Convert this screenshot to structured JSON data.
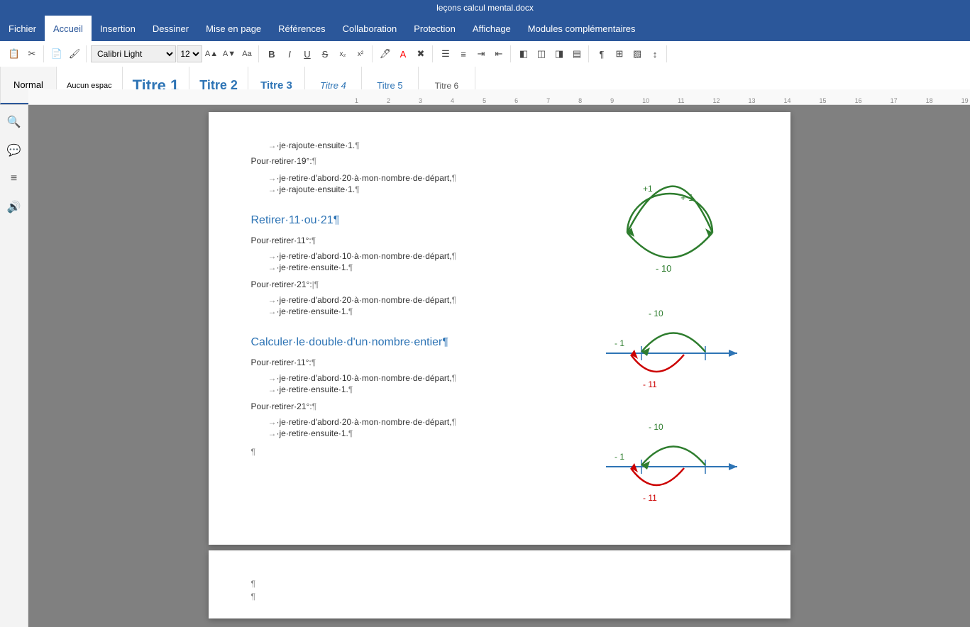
{
  "titlebar": {
    "text": "leçons calcul mental.docx"
  },
  "menu": {
    "items": [
      {
        "id": "fichier",
        "label": "Fichier",
        "active": false
      },
      {
        "id": "accueil",
        "label": "Accueil",
        "active": true
      },
      {
        "id": "insertion",
        "label": "Insertion",
        "active": false
      },
      {
        "id": "dessiner",
        "label": "Dessiner",
        "active": false
      },
      {
        "id": "miseenpage",
        "label": "Mise en page",
        "active": false
      },
      {
        "id": "references",
        "label": "Références",
        "active": false
      },
      {
        "id": "collaboration",
        "label": "Collaboration",
        "active": false
      },
      {
        "id": "protection",
        "label": "Protection",
        "active": false
      },
      {
        "id": "affichage",
        "label": "Affichage",
        "active": false
      },
      {
        "id": "modules",
        "label": "Modules complémentaires",
        "active": false
      }
    ]
  },
  "styles": [
    {
      "id": "normal",
      "label": "Normal",
      "class": ""
    },
    {
      "id": "aucun",
      "label": "Aucun espac",
      "class": ""
    },
    {
      "id": "titre1",
      "label": "Titre 1",
      "class": "titre1"
    },
    {
      "id": "titre2",
      "label": "Titre 2",
      "class": "titre2"
    },
    {
      "id": "titre3",
      "label": "Titre 3",
      "class": "titre3"
    },
    {
      "id": "titre4",
      "label": "Titre 4",
      "class": "titre4"
    },
    {
      "id": "titre5",
      "label": "Titre 5",
      "class": "titre5"
    },
    {
      "id": "titre6",
      "label": "Titre 6",
      "class": "titre6"
    }
  ],
  "toolbar": {
    "font": "Calibri Light",
    "size": "12",
    "bold": "B",
    "italic": "I",
    "underline": "U",
    "strikethrough": "S"
  },
  "sidebar": {
    "icons": [
      "🔍",
      "💬",
      "≡",
      "🔊"
    ]
  },
  "document": {
    "page1": {
      "lines_top": [
        {
          "type": "indent",
          "text": "→·je·rajoute·ensuite·1.¶"
        },
        {
          "type": "blank"
        },
        {
          "type": "para",
          "text": "Pour·retirer·19°:¶"
        },
        {
          "type": "blank"
        },
        {
          "type": "indent",
          "text": "→·je·retire·d'abord·20·à·mon·nombre·de·départ,¶"
        },
        {
          "type": "indent",
          "text": "→·je·rajoute·ensuite·1.¶"
        }
      ],
      "heading1": "Retirer·11·ou·21¶",
      "section1": [
        {
          "type": "para",
          "text": "Pour·retirer·11°:¶"
        },
        {
          "type": "indent",
          "text": "→·je·retire·d'abord·10·à·mon·nombre·de·départ,¶"
        },
        {
          "type": "indent",
          "text": "→·je·retire·ensuite·1.¶"
        },
        {
          "type": "para",
          "text": "Pour·retirer·21°:¶"
        },
        {
          "type": "indent",
          "text": "→·je·retire·d'abord·20·à·mon·nombre·de·départ,¶"
        },
        {
          "type": "indent",
          "text": "→·je·retire·ensuite·1.¶"
        }
      ],
      "heading2": "Calculer·le·double·d'un·nombre·entier¶",
      "section2": [
        {
          "type": "para",
          "text": "Pour·retirer·11°:¶"
        },
        {
          "type": "indent",
          "text": "→·je·retire·d'abord·10·à·mon·nombre·de·départ,¶"
        },
        {
          "type": "indent",
          "text": "→·je·retire·ensuite·1.¶"
        },
        {
          "type": "para",
          "text": "Pour·retirer·21°:¶"
        },
        {
          "type": "indent",
          "text": "→·je·retire·d'abord·20·à·mon·nombre·de·départ,¶"
        },
        {
          "type": "indent",
          "text": "→·je·retire·ensuite·1.¶"
        },
        {
          "type": "pilcrow",
          "text": "¶"
        }
      ]
    },
    "page2": {
      "lines": [
        "¶",
        "¶"
      ]
    }
  }
}
